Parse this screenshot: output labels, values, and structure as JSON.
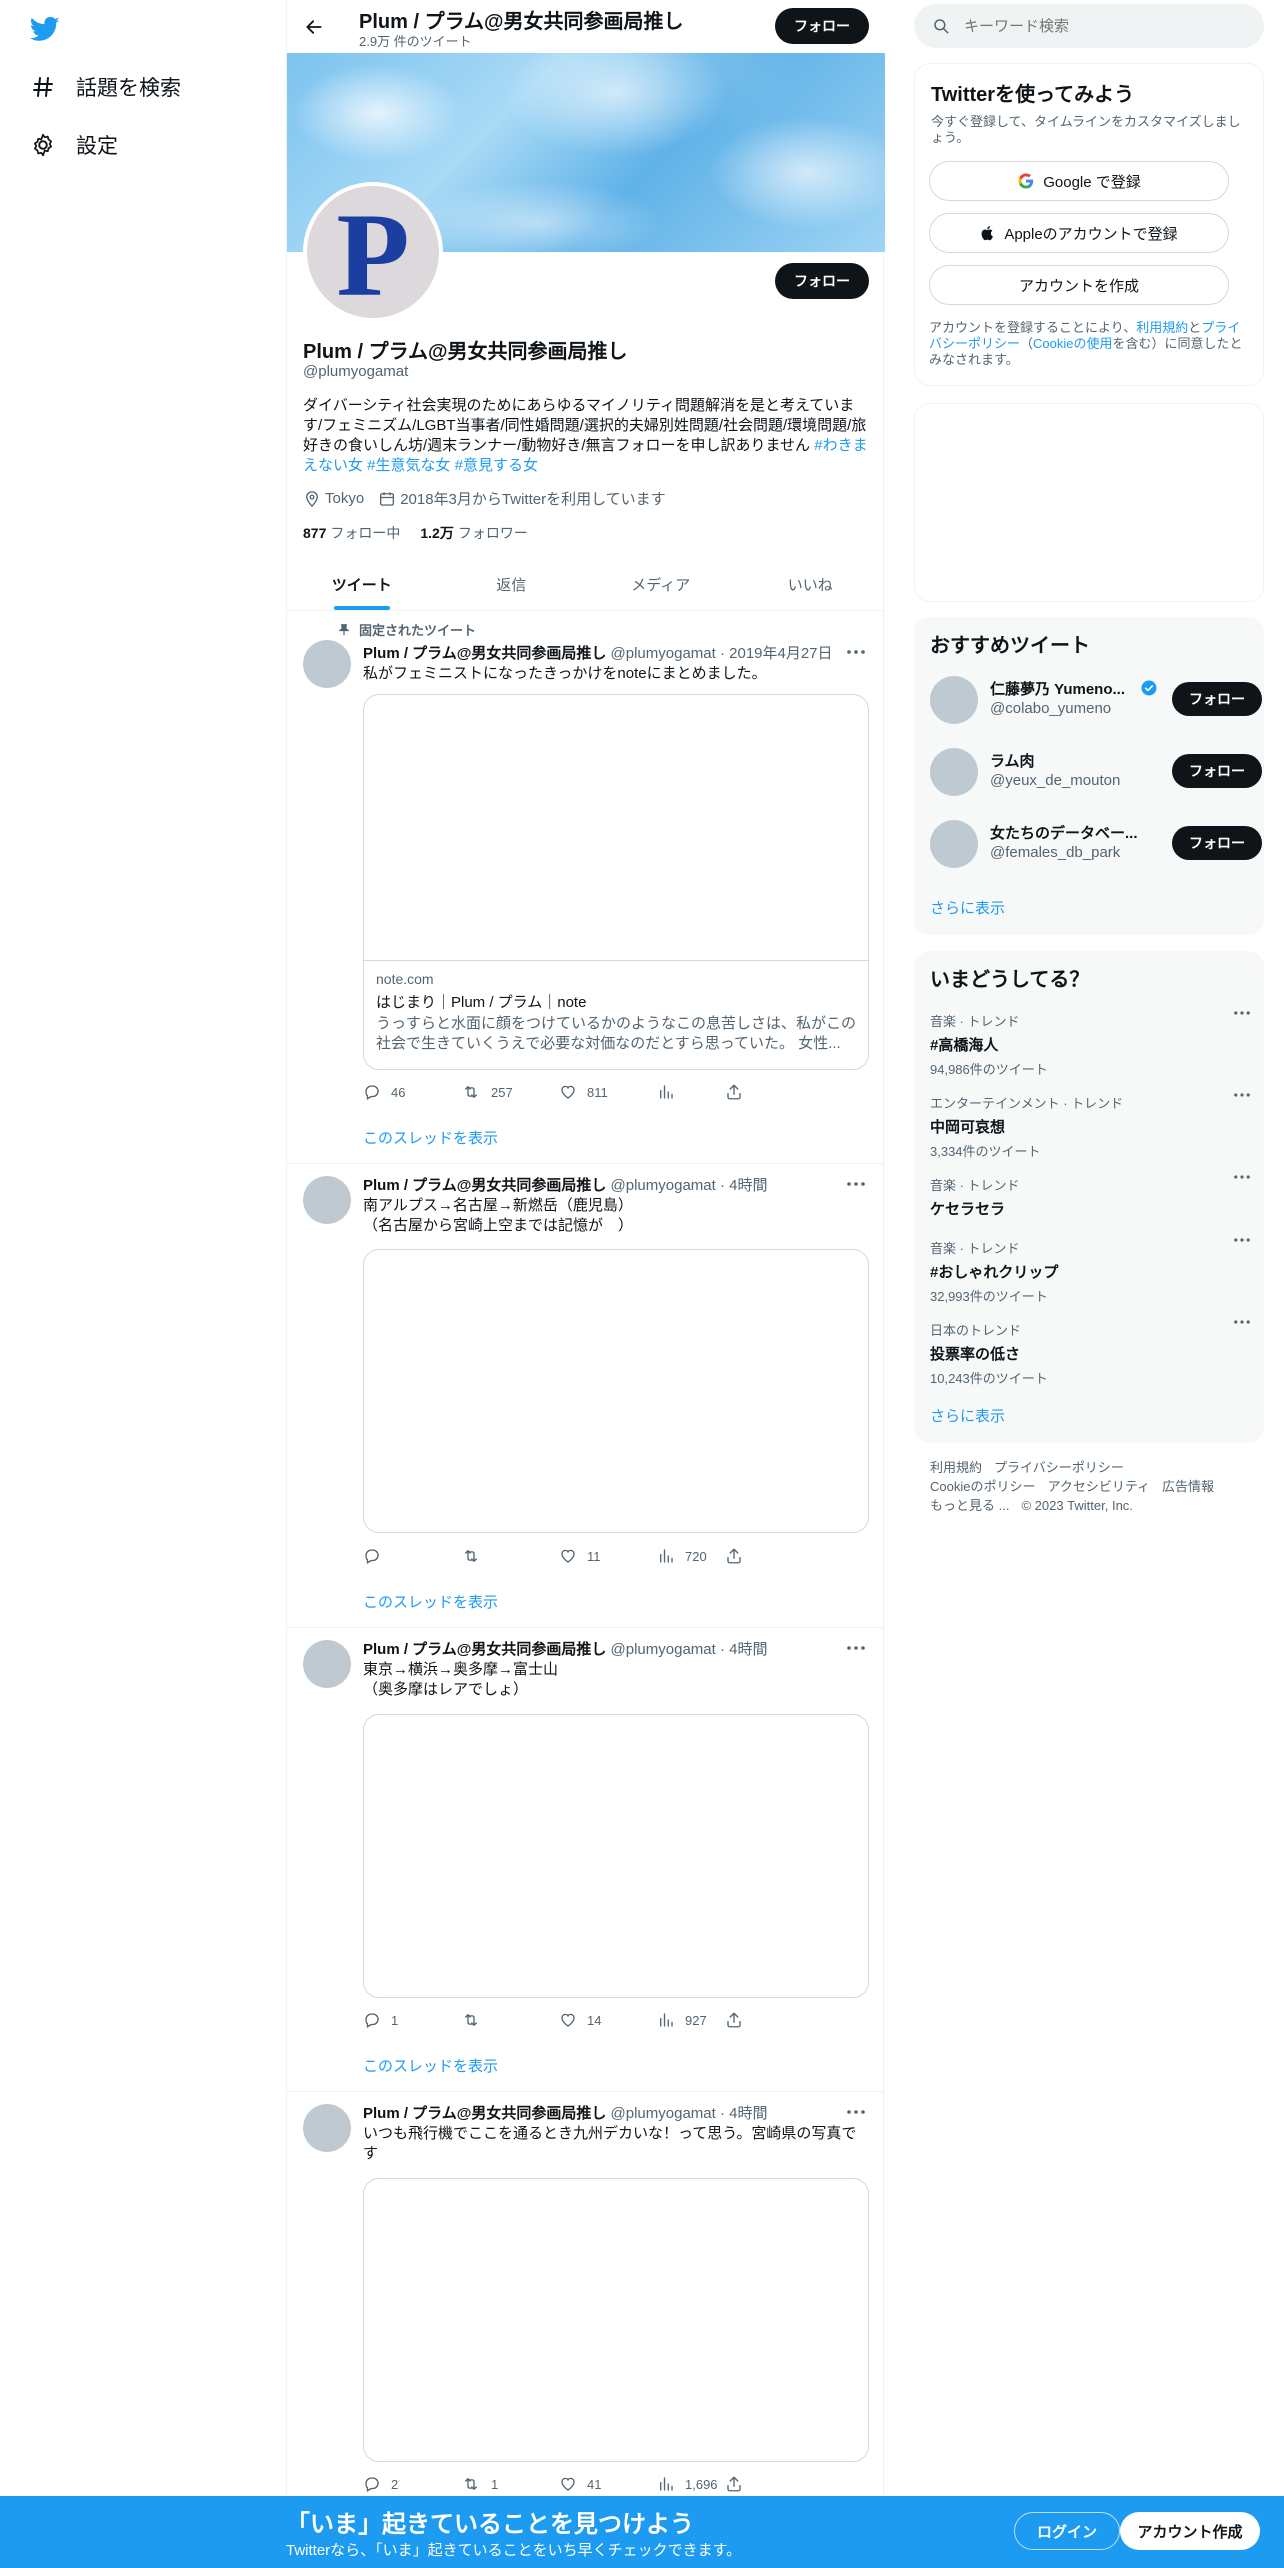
{
  "nav": {
    "items": [
      {
        "label": "話題を検索",
        "icon": "hashtag-icon"
      },
      {
        "label": "設定",
        "icon": "gear-icon"
      }
    ]
  },
  "header": {
    "title": "Plum / プラム@男女共同参画局推し",
    "subtitle": "2.9万 件のツイート",
    "follow_label": "フォロー"
  },
  "profile": {
    "avatar_letter": "P",
    "name": "Plum / プラム@男女共同参画局推し",
    "handle": "@plumyogamat",
    "bio": "ダイバーシティ社会実現のためにあらゆるマイノリティ問題解消を是と考えています/フェミニズム/LGBT当事者/同性婚問題/選択的夫婦別姓問題/社会問題/環境問題/旅好きの食いしん坊/週末ランナー/動物好き/無言フォローを申し訳ありません",
    "bio_tags": "#わきまえない女 #生意気な女 #意見する女",
    "location": "Tokyo",
    "joined": "2018年3月からTwitterを利用しています",
    "following_count": "877",
    "following_label": "フォロー中",
    "followers_count": "1.2万",
    "followers_label": "フォロワー",
    "follow_label": "フォロー"
  },
  "tabs": [
    "ツイート",
    "返信",
    "メディア",
    "いいね"
  ],
  "tweets": [
    {
      "pinned_label": "固定されたツイート",
      "name": "Plum / プラム@男女共同参画局推し",
      "handle_time": "@plumyogamat · 2019年4月27日",
      "text": "私がフェミニストになったきっかけをnoteにまとめました。",
      "card_domain": "note.com",
      "card_title": "はじまり｜Plum / プラム｜note",
      "card_desc": "うっすらと水面に顔をつけているかのようなこの息苦しさは、私がこの社会で生きていくうえで必要な対価なのだとすら思っていた。 女性...",
      "replies": "46",
      "retweets": "257",
      "likes": "811",
      "views": "",
      "thread_link": "このスレッドを表示"
    },
    {
      "name": "Plum / プラム@男女共同参画局推し",
      "handle_time": "@plumyogamat · 4時間",
      "text_line1": "南アルプス→名古屋→新燃岳（鹿児島）",
      "text_line2": "（名古屋から宮崎上空までは記憶が　）",
      "replies": "",
      "retweets": "",
      "likes": "11",
      "views": "720",
      "thread_link": "このスレッドを表示"
    },
    {
      "name": "Plum / プラム@男女共同参画局推し",
      "handle_time": "@plumyogamat · 4時間",
      "text_line1": "東京→横浜→奥多摩→富士山",
      "text_line2": "（奥多摩はレアでしょ）",
      "replies": "1",
      "retweets": "",
      "likes": "14",
      "views": "927",
      "thread_link": "このスレッドを表示"
    },
    {
      "name": "Plum / プラム@男女共同参画局推し",
      "handle_time": "@plumyogamat · 4時間",
      "text": "いつも飛行機でここを通るとき九州デカいな！って思う。宮崎県の写真です",
      "replies": "2",
      "retweets": "1",
      "likes": "41",
      "views": "1,696"
    }
  ],
  "search": {
    "placeholder": "キーワード検索"
  },
  "signup": {
    "title": "Twitterを使ってみよう",
    "desc": "今すぐ登録して、タイムラインをカスタマイズしましょう。",
    "google_label": "Google で登録",
    "apple_label": "Appleのアカウントで登録",
    "create_label": "アカウントを作成",
    "terms_pre": "アカウントを登録することにより、",
    "terms_link1": "利用規約",
    "terms_mid1": "と",
    "terms_link2": "プライバシーポリシー",
    "terms_mid2": "（",
    "terms_link3": "Cookieの使用",
    "terms_post": "を含む）に同意したとみなされます。"
  },
  "recommended": {
    "title": "おすすめツイート",
    "users": [
      {
        "name": "仁藤夢乃 Yumeno...",
        "handle": "@colabo_yumeno",
        "verified": true
      },
      {
        "name": "ラム肉",
        "handle": "@yeux_de_mouton",
        "verified": false
      },
      {
        "name": "女たちのデータベー...",
        "handle": "@females_db_park",
        "verified": false
      }
    ],
    "follow_label": "フォロー",
    "more": "さらに表示"
  },
  "trends": {
    "title": "いまどうしてる？",
    "items": [
      {
        "category": "音楽 · トレンド",
        "topic": "#高橋海人",
        "count": "94,986件のツイート"
      },
      {
        "category": "エンターテインメント · トレンド",
        "topic": "中岡可哀想",
        "count": "3,334件のツイート"
      },
      {
        "category": "音楽 · トレンド",
        "topic": "ケセラセラ",
        "count": ""
      },
      {
        "category": "音楽 · トレンド",
        "topic": "#おしゃれクリップ",
        "count": "32,993件のツイート"
      },
      {
        "category": "日本のトレンド",
        "topic": "投票率の低さ",
        "count": "10,243件のツイート"
      }
    ],
    "more": "さらに表示"
  },
  "footer": {
    "links": [
      "利用規約",
      "プライバシーポリシー",
      "Cookieのポリシー",
      "アクセシビリティ",
      "広告情報",
      "もっと見る ...",
      "© 2023 Twitter, Inc."
    ]
  },
  "bottombar": {
    "title": "「いま」起きていることを見つけよう",
    "subtitle": "Twitterなら、「いま」起きていることをいち早くチェックできます。",
    "login": "ログイン",
    "signup": "アカウント作成"
  },
  "colors": {
    "accent": "#1d9bf0",
    "text": "#0f1419",
    "muted": "#536471",
    "bottombar": "#1d9bf0"
  }
}
